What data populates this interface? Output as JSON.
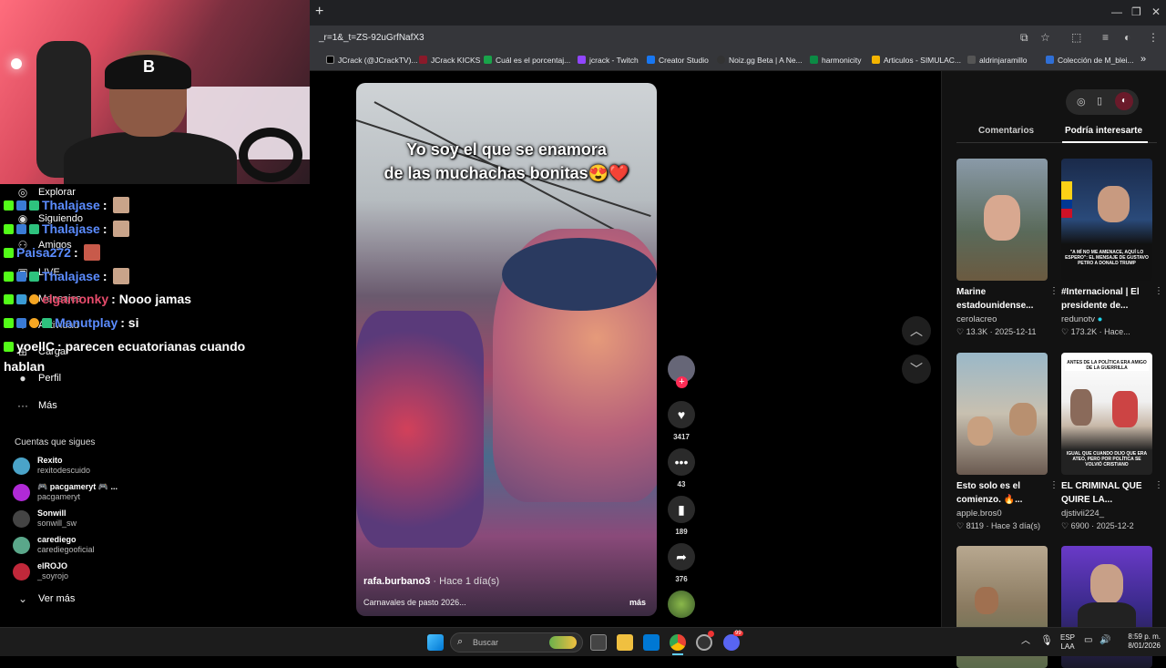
{
  "browser": {
    "new_tab": "+",
    "url": "_r=1&_t=ZS-92uGrfNafX3",
    "window_controls": [
      "—",
      "❐",
      "✕"
    ],
    "bookmarks": [
      {
        "label": "JCrack (@JCrackTV)...",
        "color": "#000000"
      },
      {
        "label": "JCrack KICKS",
        "color": "#8a1a2a"
      },
      {
        "label": "Cuál es el porcentaj...",
        "color": "#19a34a"
      },
      {
        "label": "jcrack - Twitch",
        "color": "#9146ff"
      },
      {
        "label": "Creator Studio",
        "color": "#1877f2"
      },
      {
        "label": "Noiz.gg Beta | A Ne...",
        "color": "#333333"
      },
      {
        "label": "harmonicity",
        "color": "#0b8a44"
      },
      {
        "label": "Articulos - SIMULAC...",
        "color": "#f4b400"
      },
      {
        "label": "aldrinjaramillo",
        "color": "#555555"
      },
      {
        "label": "Colección de M_blei...",
        "color": "#2f6fd6"
      }
    ],
    "bookmarks_more": "»"
  },
  "sidebar": {
    "nav": [
      {
        "label": "Explorar",
        "icon": "compass-icon",
        "glyph": "◎"
      },
      {
        "label": "Siguiendo",
        "icon": "following-icon",
        "glyph": "◉"
      },
      {
        "label": "Amigos",
        "icon": "friends-icon",
        "glyph": "⚇"
      },
      {
        "label": "LIVE",
        "icon": "live-icon",
        "glyph": "▣"
      },
      {
        "label": "Mensajes",
        "icon": "messages-icon",
        "glyph": "✉"
      },
      {
        "label": "Actividad",
        "icon": "activity-icon",
        "glyph": "♢"
      },
      {
        "label": "Cargar",
        "icon": "upload-icon",
        "glyph": "⊞"
      },
      {
        "label": "Perfil",
        "icon": "profile-icon",
        "glyph": "●"
      },
      {
        "label": "Más",
        "icon": "more-icon",
        "glyph": "···"
      }
    ],
    "following_title": "Cuentas que sigues",
    "following": [
      {
        "name": "Rexito",
        "handle": "rexitodescuido",
        "color": "#4aa3c8"
      },
      {
        "name": "🎮 pacgameryt 🎮 ...",
        "handle": "pacgameryt",
        "color": "#b02ad6"
      },
      {
        "name": "Sonwill",
        "handle": "sonwill_sw",
        "color": "#444444"
      },
      {
        "name": "carediego",
        "handle": "carediegooficial",
        "color": "#5aa78a"
      },
      {
        "name": "elROJO",
        "handle": "_soyrojo",
        "color": "#c0283a"
      }
    ],
    "see_more": "Ver más"
  },
  "chat": [
    {
      "user": "Thalajase",
      "text": ":",
      "style": "user"
    },
    {
      "user": "Thalajase",
      "text": ":",
      "style": "user"
    },
    {
      "user": "Paisa272",
      "text": ":",
      "style": "user"
    },
    {
      "user": "Thalajase",
      "text": ":",
      "style": "user"
    },
    {
      "user": "elgamonky",
      "text": ": Nooo jamas",
      "style": "user2"
    },
    {
      "user": "Manutplay",
      "text": ": si",
      "style": "user"
    },
    {
      "user": "yoellC",
      "text": ": parecen ecuatorianas cuando",
      "style": "white"
    },
    {
      "user": "",
      "text": "hablan",
      "style": "white"
    }
  ],
  "video": {
    "caption_line1": "Yo soy el que se enamora",
    "caption_line2": "de las muchachas bonitas😍❤️",
    "author": "rafa.burbano3",
    "time": " · Hace 1 día(s)",
    "description": "Carnavales de pasto 2026...",
    "more": "más"
  },
  "actions": {
    "likes": "3417",
    "comments": "43",
    "saves": "189",
    "shares": "376"
  },
  "right_panel": {
    "tabs": [
      "Comentarios",
      "Podría interesarte"
    ],
    "cards": [
      {
        "title": "Marine estadounidense...",
        "author": "cerolacreo",
        "likes": "13.3K",
        "date": "2025-12-11",
        "verified": false,
        "bg": "linear-gradient(180deg,#8a9aa8,#5a6a5a 60%,#6b5a40)"
      },
      {
        "title": "#Internacional | El presidente de...",
        "author": "redunotv",
        "likes": "173.2K",
        "date": "Hace...",
        "verified": true,
        "bg": "linear-gradient(180deg,#1a2a4a,#2a4a7a 50%,#111 70%)",
        "overlay": "\"A MÍ NO ME AMENACE, AQUÍ LO ESPERO\": EL MENSAJE DE GUSTAVO PETRO A DONALD TRUMP"
      },
      {
        "title": "Esto solo es el comienzo. 🔥...",
        "author": "apple.bros0",
        "likes": "8119",
        "date": "Hace 3 día(s)",
        "verified": false,
        "bg": "linear-gradient(180deg,#9ab8c8,#c8c0b0 50%,#6a5a50)"
      },
      {
        "title": "EL CRIMINAL QUE QUIRE LA...",
        "author": "djstivii224_",
        "likes": "6900",
        "date": "2025-12-2",
        "verified": false,
        "bg": "linear-gradient(180deg,#ffffff,#f0f0f0 40%,#c8b8a8 60%,#222 80%)",
        "overlay_top": "ANTES DE LA POLÍTICA ERA AMIGO DE LA GUERRILLA",
        "overlay_bottom": "IGUAL QUE CUANDO DIJO QUE ERA ATEO, PERO POR POLÍTICA SE VOLVIÓ CRISTIANO"
      },
      {
        "title": "",
        "author": "",
        "likes": "",
        "date": "",
        "verified": false,
        "bg": "linear-gradient(180deg,#b8a890,#8a7a60 50%,#5a6a4a)"
      },
      {
        "title": "",
        "author": "",
        "likes": "",
        "date": "",
        "verified": false,
        "bg": "linear-gradient(180deg,#6a3ac8,#3a2a8a 50%,#1a1a2a)"
      }
    ]
  },
  "taskbar": {
    "search_placeholder": "Buscar",
    "lang_top": "ESP",
    "lang_bottom": "LAA",
    "time": "8:59 p. m.",
    "date": "8/01/2026",
    "badge": "99"
  }
}
